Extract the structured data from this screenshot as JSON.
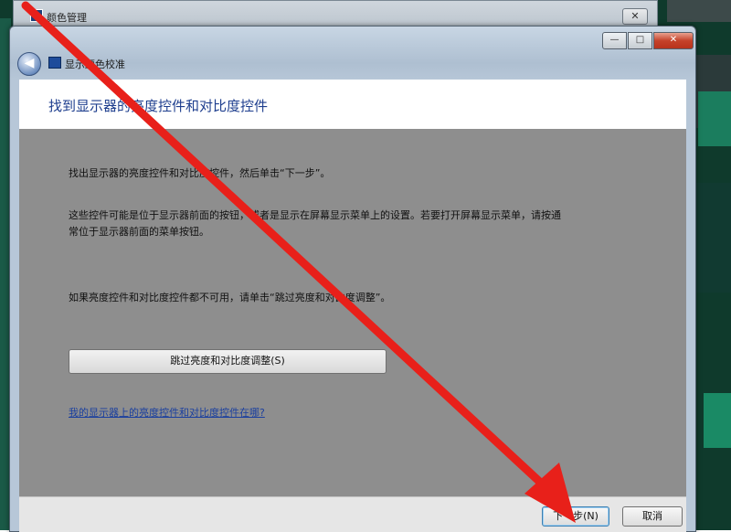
{
  "background_window": {
    "title": "颜色管理",
    "close_glyph": "✕"
  },
  "window": {
    "caption": {
      "minimize": "—",
      "maximize": "□",
      "close": "✕"
    },
    "back_glyph": "◀",
    "nav_title": "显示颜色校准"
  },
  "header": {
    "title": "找到显示器的亮度控件和对比度控件"
  },
  "content": {
    "para1": "找出显示器的亮度控件和对比度控件，然后单击“下一步”。",
    "para2_line1": "这些控件可能是位于显示器前面的按钮，或者是显示在屏幕显示菜单上的设置。若要打开屏幕显示菜单，请按通",
    "para2_line2": "常位于显示器前面的菜单按钮。",
    "para3": "如果亮度控件和对比度控件都不可用，请单击“跳过亮度和对比度调整”。",
    "skip_button": "跳过亮度和对比度调整(S)",
    "help_link": "我的显示器上的亮度控件和对比度控件在哪?"
  },
  "footer": {
    "next_button": "下一步(N)",
    "cancel_button": "取消"
  },
  "colors": {
    "arrow": "#e8201a",
    "header_text": "#1e3e8e",
    "link": "#1a3f9f"
  },
  "icons": [
    "back-arrow-icon",
    "display-icon",
    "window-icon",
    "close-icon",
    "minimize-icon",
    "maximize-icon",
    "red-arrow-annotation"
  ]
}
